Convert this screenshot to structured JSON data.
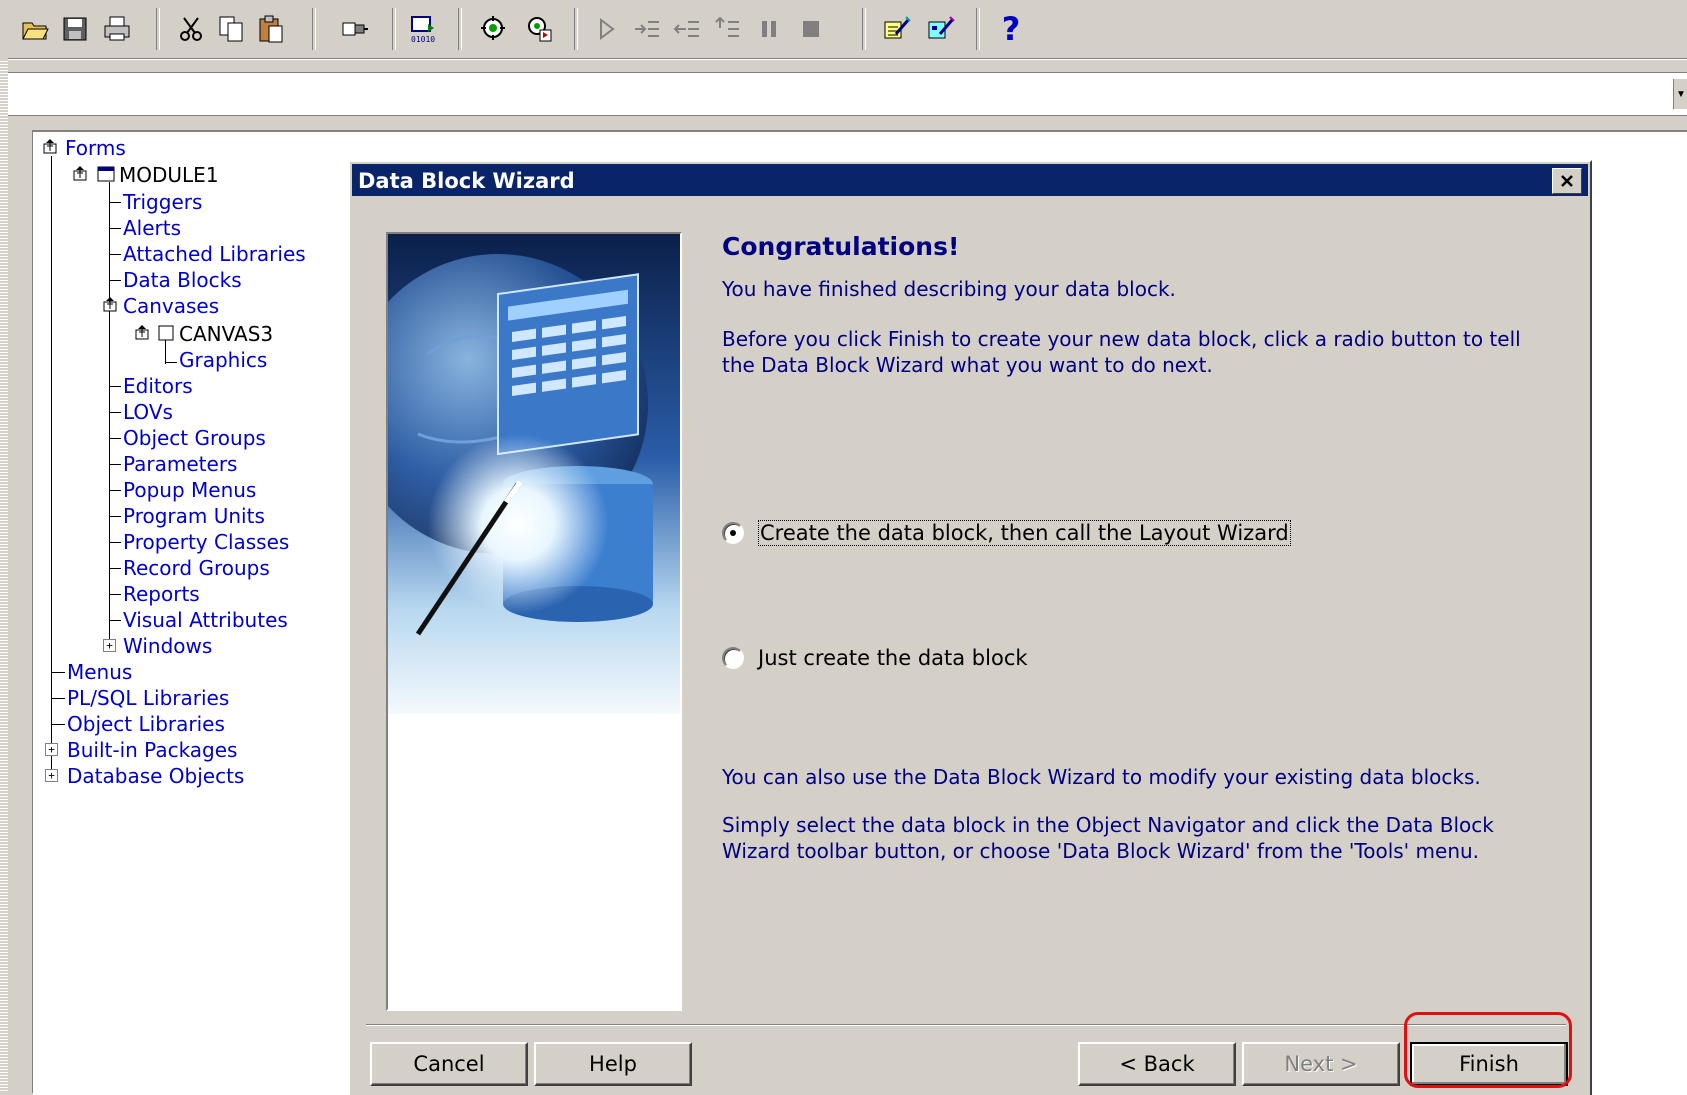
{
  "toolbar": {
    "buttons": [
      {
        "icon": "open-folder-icon"
      },
      {
        "icon": "save-icon"
      },
      {
        "icon": "print-icon"
      },
      {
        "icon": "cut-icon"
      },
      {
        "icon": "copy-icon"
      },
      {
        "icon": "paste-icon"
      },
      {
        "icon": "connect-icon"
      },
      {
        "icon": "compile-icon"
      },
      {
        "icon": "run-form-icon"
      },
      {
        "icon": "debug-run-icon"
      },
      {
        "icon": "go-icon"
      },
      {
        "icon": "step-into-icon"
      },
      {
        "icon": "step-out-icon"
      },
      {
        "icon": "step-over-icon"
      },
      {
        "icon": "pause-icon"
      },
      {
        "icon": "stop-icon"
      },
      {
        "icon": "data-block-wizard-icon"
      },
      {
        "icon": "layout-wizard-icon"
      },
      {
        "icon": "help-icon",
        "label": "?"
      }
    ]
  },
  "navigator": {
    "items": [
      {
        "label": "Forms"
      },
      {
        "label": "MODULE1"
      },
      {
        "label": "Triggers"
      },
      {
        "label": "Alerts"
      },
      {
        "label": "Attached Libraries"
      },
      {
        "label": "Data Blocks"
      },
      {
        "label": "Canvases"
      },
      {
        "label": "CANVAS3"
      },
      {
        "label": "Graphics"
      },
      {
        "label": "Editors"
      },
      {
        "label": "LOVs"
      },
      {
        "label": "Object Groups"
      },
      {
        "label": "Parameters"
      },
      {
        "label": "Popup Menus"
      },
      {
        "label": "Program Units"
      },
      {
        "label": "Property Classes"
      },
      {
        "label": "Record Groups"
      },
      {
        "label": "Reports"
      },
      {
        "label": "Visual Attributes"
      },
      {
        "label": "Windows"
      },
      {
        "label": "Menus"
      },
      {
        "label": "PL/SQL Libraries"
      },
      {
        "label": "Object Libraries"
      },
      {
        "label": "Built-in Packages"
      },
      {
        "label": "Database Objects"
      }
    ]
  },
  "dialog": {
    "title": "Data Block Wizard",
    "heading": "Congratulations!",
    "finished_text": "You have finished describing your data block.",
    "instruction_text": "Before you click Finish to create your new data block, click a radio button to tell the Data Block Wizard what you want to do next.",
    "options": [
      {
        "label": "Create the data block, then call the Layout Wizard",
        "selected": true
      },
      {
        "label": "Just create the data block",
        "selected": false
      }
    ],
    "modify_text": "You can also use the Data Block Wizard to modify your existing data blocks.",
    "select_text": "Simply select the data block in the Object Navigator and click the Data Block Wizard toolbar button, or choose 'Data Block Wizard' from the 'Tools' menu.",
    "buttons": {
      "cancel": "Cancel",
      "help": "Help",
      "back": "< Back",
      "next": "Next >",
      "finish": "Finish"
    }
  }
}
